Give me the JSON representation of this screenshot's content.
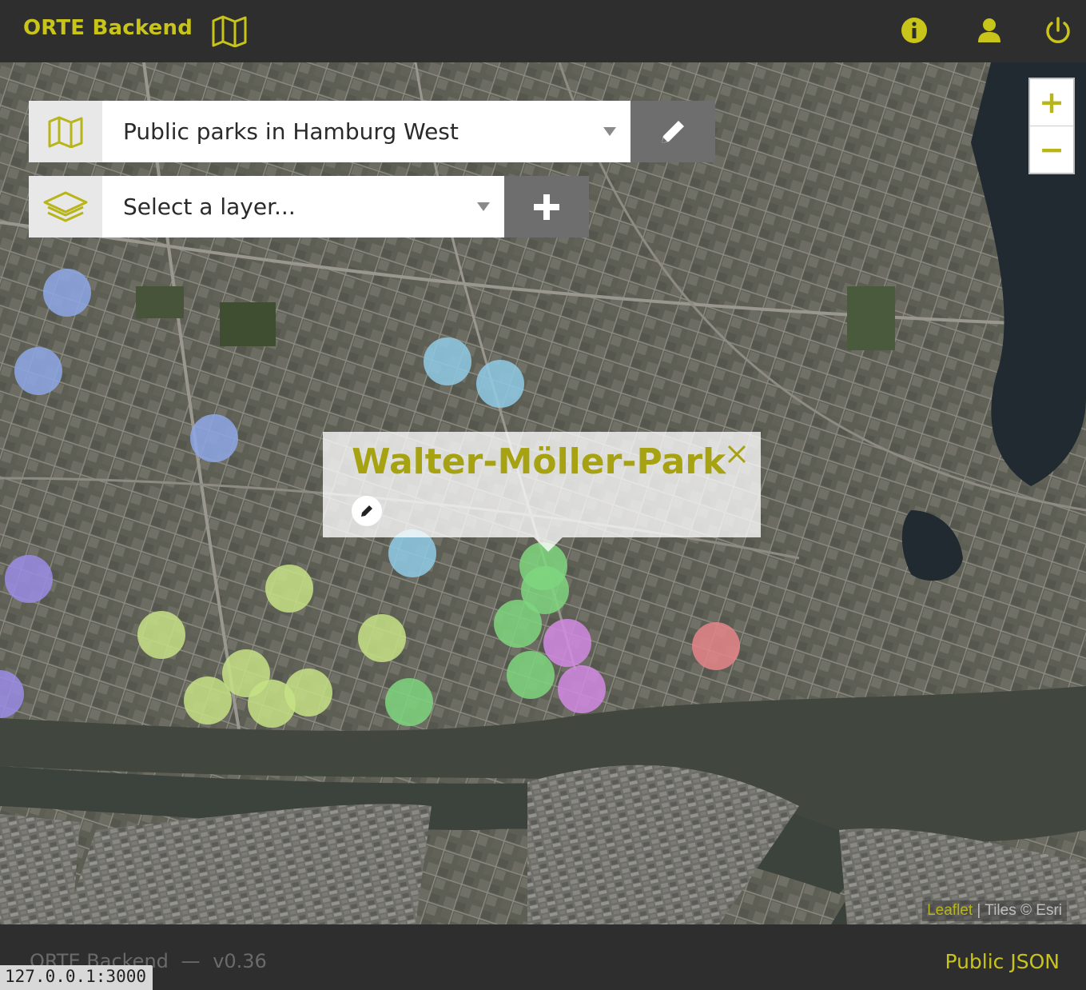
{
  "header": {
    "title": "ORTE Backend",
    "icons": [
      "map-icon",
      "info-icon",
      "user-icon",
      "power-icon"
    ],
    "accent_color": "#c8c41a"
  },
  "controls": {
    "map_select_value": "Public parks in Hamburg West",
    "layer_select_placeholder": "Select a layer...",
    "edit_icon": "pencil-icon",
    "add_icon": "plus-icon"
  },
  "zoom": {
    "in_label": "+",
    "out_label": "−"
  },
  "popup": {
    "title": "Walter-Möller-Park",
    "close_icon": "close-icon",
    "edit_icon": "pencil-icon"
  },
  "map": {
    "marker_colors": {
      "blue": "#8ea8e8",
      "cyan": "#8fcbe6",
      "purple": "#9b8ce6",
      "lime": "#c6e285",
      "green": "#7fd67f",
      "magenta": "#d28ae3",
      "red": "#e6858a"
    }
  },
  "attribution": {
    "leaflet": "Leaflet",
    "tiles": " | Tiles © Esri"
  },
  "footer": {
    "app_name": "ORTE Backend",
    "separator": "—",
    "version": "v0.36",
    "public_json": "Public JSON"
  },
  "status_bar": {
    "url": "127.0.0.1:3000"
  }
}
